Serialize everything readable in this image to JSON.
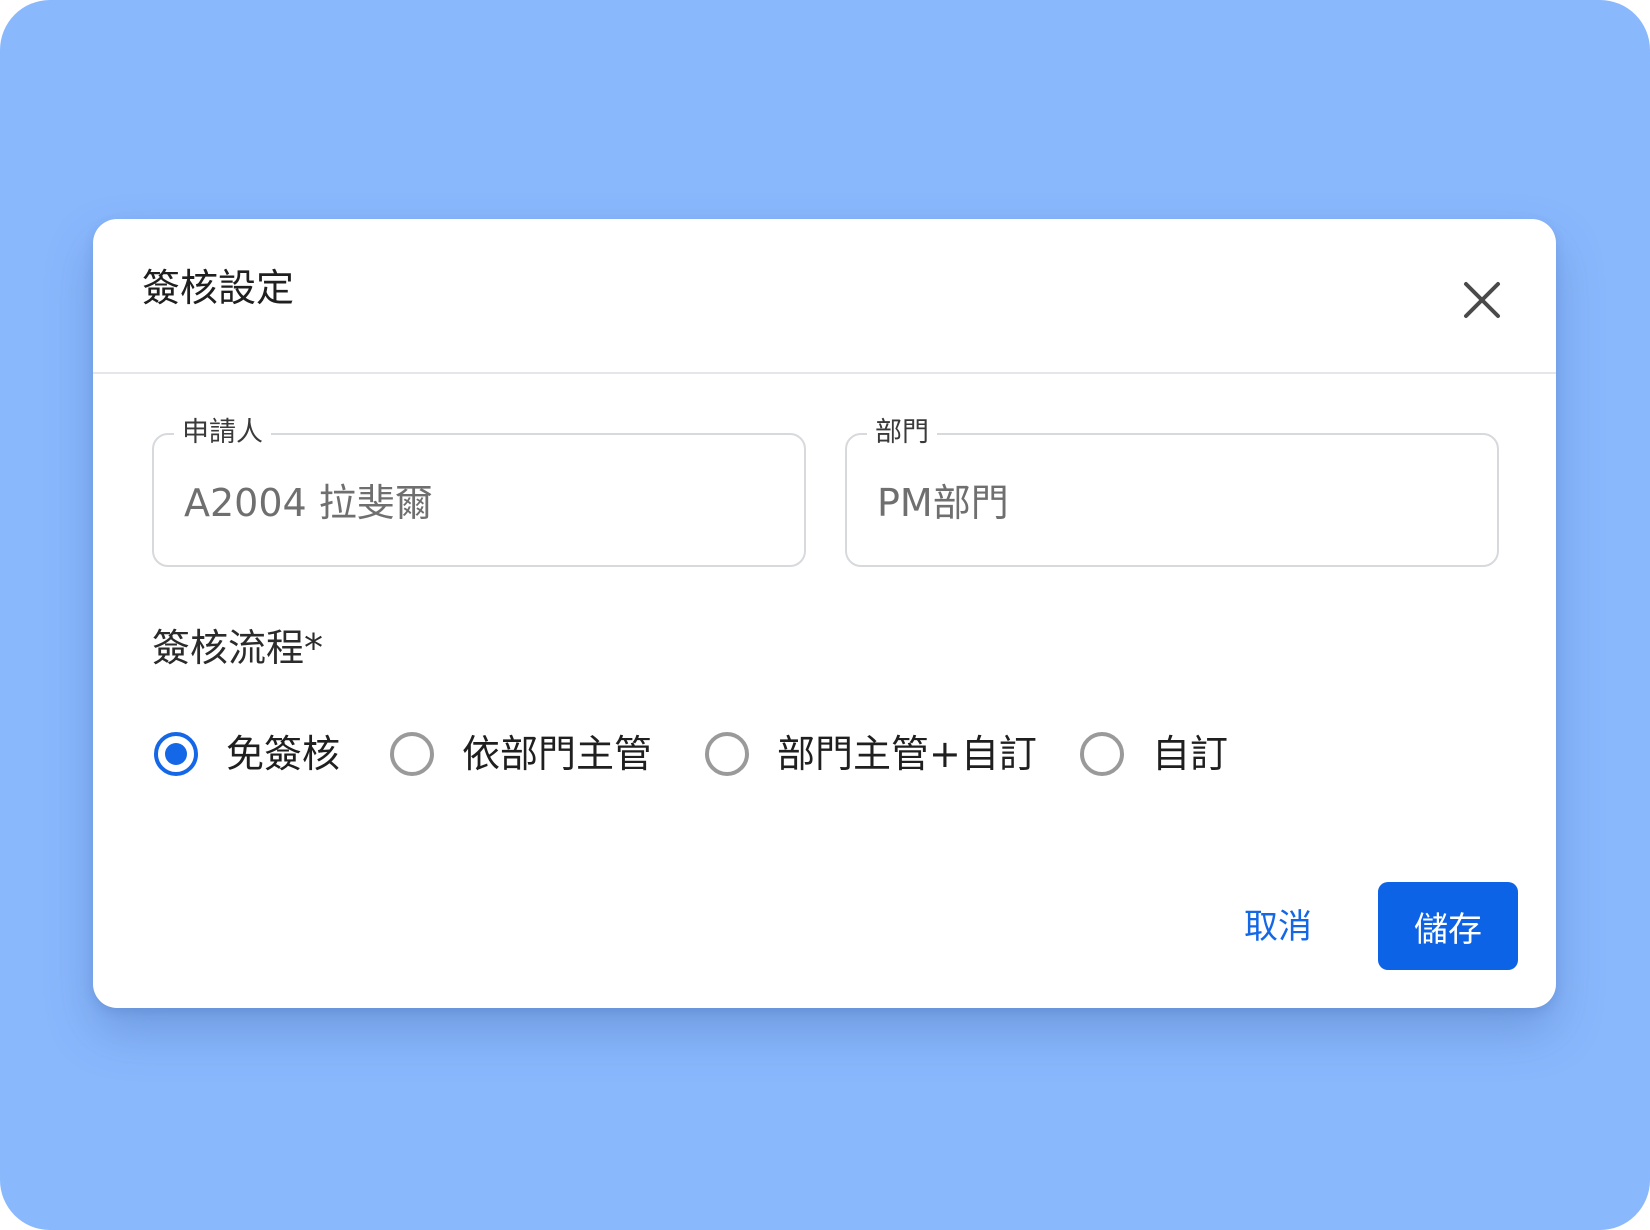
{
  "dialog": {
    "title": "簽核設定"
  },
  "fields": {
    "applicant": {
      "label": "申請人",
      "value": "A2004 拉斐爾"
    },
    "department": {
      "label": "部門",
      "value": "PM部門"
    }
  },
  "approval_flow": {
    "label": "簽核流程*",
    "selected": "免簽核",
    "options": [
      {
        "label": "免簽核",
        "checked": true
      },
      {
        "label": "依部門主管",
        "checked": false
      },
      {
        "label": "部門主管+自訂",
        "checked": false
      },
      {
        "label": "自訂",
        "checked": false
      }
    ]
  },
  "actions": {
    "cancel_label": "取消",
    "save_label": "儲存"
  },
  "colors": {
    "backdrop": "#8ab8fd",
    "accent": "#1467e6",
    "save_button": "#0d63e6"
  },
  "icons": {
    "close": "close-icon"
  }
}
